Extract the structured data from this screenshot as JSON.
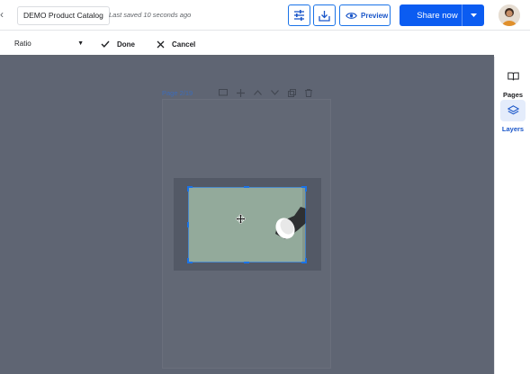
{
  "header": {
    "doc_title": "DEMO Product Catalog",
    "saved_status": "Last saved 10 seconds ago",
    "preview_label": "Preview",
    "share_label": "Share now"
  },
  "cropbar": {
    "ratio_label": "Ratio",
    "done_label": "Done",
    "cancel_label": "Cancel"
  },
  "canvas": {
    "page_label": "Page 2/19"
  },
  "rail": {
    "pages_label": "Pages",
    "layers_label": "Layers"
  },
  "colors": {
    "accent": "#1a73e8",
    "share_button": "#0b5cf1",
    "canvas_bg": "#5f6573",
    "image_bg": "#93aa9b"
  },
  "icons": {
    "settings": "sliders-icon",
    "download": "download-icon",
    "preview": "eye-icon",
    "share_caret": "caret-down-icon",
    "done": "check-icon",
    "cancel": "close-icon",
    "pages": "book-icon",
    "layers": "layers-icon",
    "move": "move-cursor-icon"
  }
}
